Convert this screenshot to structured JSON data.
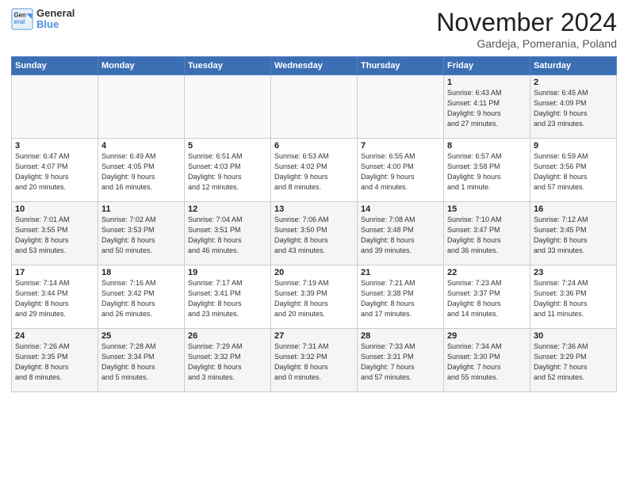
{
  "header": {
    "logo_line1": "General",
    "logo_line2": "Blue",
    "month": "November 2024",
    "location": "Gardeja, Pomerania, Poland"
  },
  "weekdays": [
    "Sunday",
    "Monday",
    "Tuesday",
    "Wednesday",
    "Thursday",
    "Friday",
    "Saturday"
  ],
  "weeks": [
    [
      {
        "day": "",
        "info": ""
      },
      {
        "day": "",
        "info": ""
      },
      {
        "day": "",
        "info": ""
      },
      {
        "day": "",
        "info": ""
      },
      {
        "day": "",
        "info": ""
      },
      {
        "day": "1",
        "info": "Sunrise: 6:43 AM\nSunset: 4:11 PM\nDaylight: 9 hours\nand 27 minutes."
      },
      {
        "day": "2",
        "info": "Sunrise: 6:45 AM\nSunset: 4:09 PM\nDaylight: 9 hours\nand 23 minutes."
      }
    ],
    [
      {
        "day": "3",
        "info": "Sunrise: 6:47 AM\nSunset: 4:07 PM\nDaylight: 9 hours\nand 20 minutes."
      },
      {
        "day": "4",
        "info": "Sunrise: 6:49 AM\nSunset: 4:05 PM\nDaylight: 9 hours\nand 16 minutes."
      },
      {
        "day": "5",
        "info": "Sunrise: 6:51 AM\nSunset: 4:03 PM\nDaylight: 9 hours\nand 12 minutes."
      },
      {
        "day": "6",
        "info": "Sunrise: 6:53 AM\nSunset: 4:02 PM\nDaylight: 9 hours\nand 8 minutes."
      },
      {
        "day": "7",
        "info": "Sunrise: 6:55 AM\nSunset: 4:00 PM\nDaylight: 9 hours\nand 4 minutes."
      },
      {
        "day": "8",
        "info": "Sunrise: 6:57 AM\nSunset: 3:58 PM\nDaylight: 9 hours\nand 1 minute."
      },
      {
        "day": "9",
        "info": "Sunrise: 6:59 AM\nSunset: 3:56 PM\nDaylight: 8 hours\nand 57 minutes."
      }
    ],
    [
      {
        "day": "10",
        "info": "Sunrise: 7:01 AM\nSunset: 3:55 PM\nDaylight: 8 hours\nand 53 minutes."
      },
      {
        "day": "11",
        "info": "Sunrise: 7:02 AM\nSunset: 3:53 PM\nDaylight: 8 hours\nand 50 minutes."
      },
      {
        "day": "12",
        "info": "Sunrise: 7:04 AM\nSunset: 3:51 PM\nDaylight: 8 hours\nand 46 minutes."
      },
      {
        "day": "13",
        "info": "Sunrise: 7:06 AM\nSunset: 3:50 PM\nDaylight: 8 hours\nand 43 minutes."
      },
      {
        "day": "14",
        "info": "Sunrise: 7:08 AM\nSunset: 3:48 PM\nDaylight: 8 hours\nand 39 minutes."
      },
      {
        "day": "15",
        "info": "Sunrise: 7:10 AM\nSunset: 3:47 PM\nDaylight: 8 hours\nand 36 minutes."
      },
      {
        "day": "16",
        "info": "Sunrise: 7:12 AM\nSunset: 3:45 PM\nDaylight: 8 hours\nand 33 minutes."
      }
    ],
    [
      {
        "day": "17",
        "info": "Sunrise: 7:14 AM\nSunset: 3:44 PM\nDaylight: 8 hours\nand 29 minutes."
      },
      {
        "day": "18",
        "info": "Sunrise: 7:16 AM\nSunset: 3:42 PM\nDaylight: 8 hours\nand 26 minutes."
      },
      {
        "day": "19",
        "info": "Sunrise: 7:17 AM\nSunset: 3:41 PM\nDaylight: 8 hours\nand 23 minutes."
      },
      {
        "day": "20",
        "info": "Sunrise: 7:19 AM\nSunset: 3:39 PM\nDaylight: 8 hours\nand 20 minutes."
      },
      {
        "day": "21",
        "info": "Sunrise: 7:21 AM\nSunset: 3:38 PM\nDaylight: 8 hours\nand 17 minutes."
      },
      {
        "day": "22",
        "info": "Sunrise: 7:23 AM\nSunset: 3:37 PM\nDaylight: 8 hours\nand 14 minutes."
      },
      {
        "day": "23",
        "info": "Sunrise: 7:24 AM\nSunset: 3:36 PM\nDaylight: 8 hours\nand 11 minutes."
      }
    ],
    [
      {
        "day": "24",
        "info": "Sunrise: 7:26 AM\nSunset: 3:35 PM\nDaylight: 8 hours\nand 8 minutes."
      },
      {
        "day": "25",
        "info": "Sunrise: 7:28 AM\nSunset: 3:34 PM\nDaylight: 8 hours\nand 5 minutes."
      },
      {
        "day": "26",
        "info": "Sunrise: 7:29 AM\nSunset: 3:32 PM\nDaylight: 8 hours\nand 3 minutes."
      },
      {
        "day": "27",
        "info": "Sunrise: 7:31 AM\nSunset: 3:32 PM\nDaylight: 8 hours\nand 0 minutes."
      },
      {
        "day": "28",
        "info": "Sunrise: 7:33 AM\nSunset: 3:31 PM\nDaylight: 7 hours\nand 57 minutes."
      },
      {
        "day": "29",
        "info": "Sunrise: 7:34 AM\nSunset: 3:30 PM\nDaylight: 7 hours\nand 55 minutes."
      },
      {
        "day": "30",
        "info": "Sunrise: 7:36 AM\nSunset: 3:29 PM\nDaylight: 7 hours\nand 52 minutes."
      }
    ]
  ]
}
